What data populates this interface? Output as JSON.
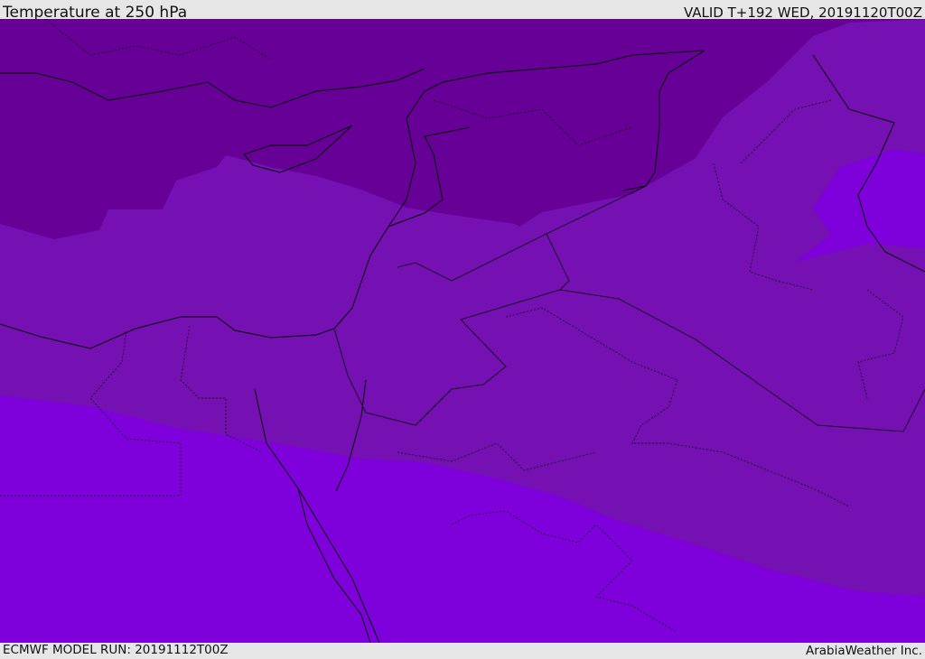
{
  "header": {
    "title": "Temperature at 250 hPa",
    "valid": "VALID T+192 WED, 20191120T00Z"
  },
  "footer": {
    "model_run": "ECMWF MODEL RUN: 20191112T00Z",
    "credit": "ArabiaWeather Inc."
  },
  "colors": {
    "cold_band": "#660096",
    "mid_band": "#7510b2",
    "warm_band": "#7e00da",
    "background": "#e6e6e6"
  }
}
